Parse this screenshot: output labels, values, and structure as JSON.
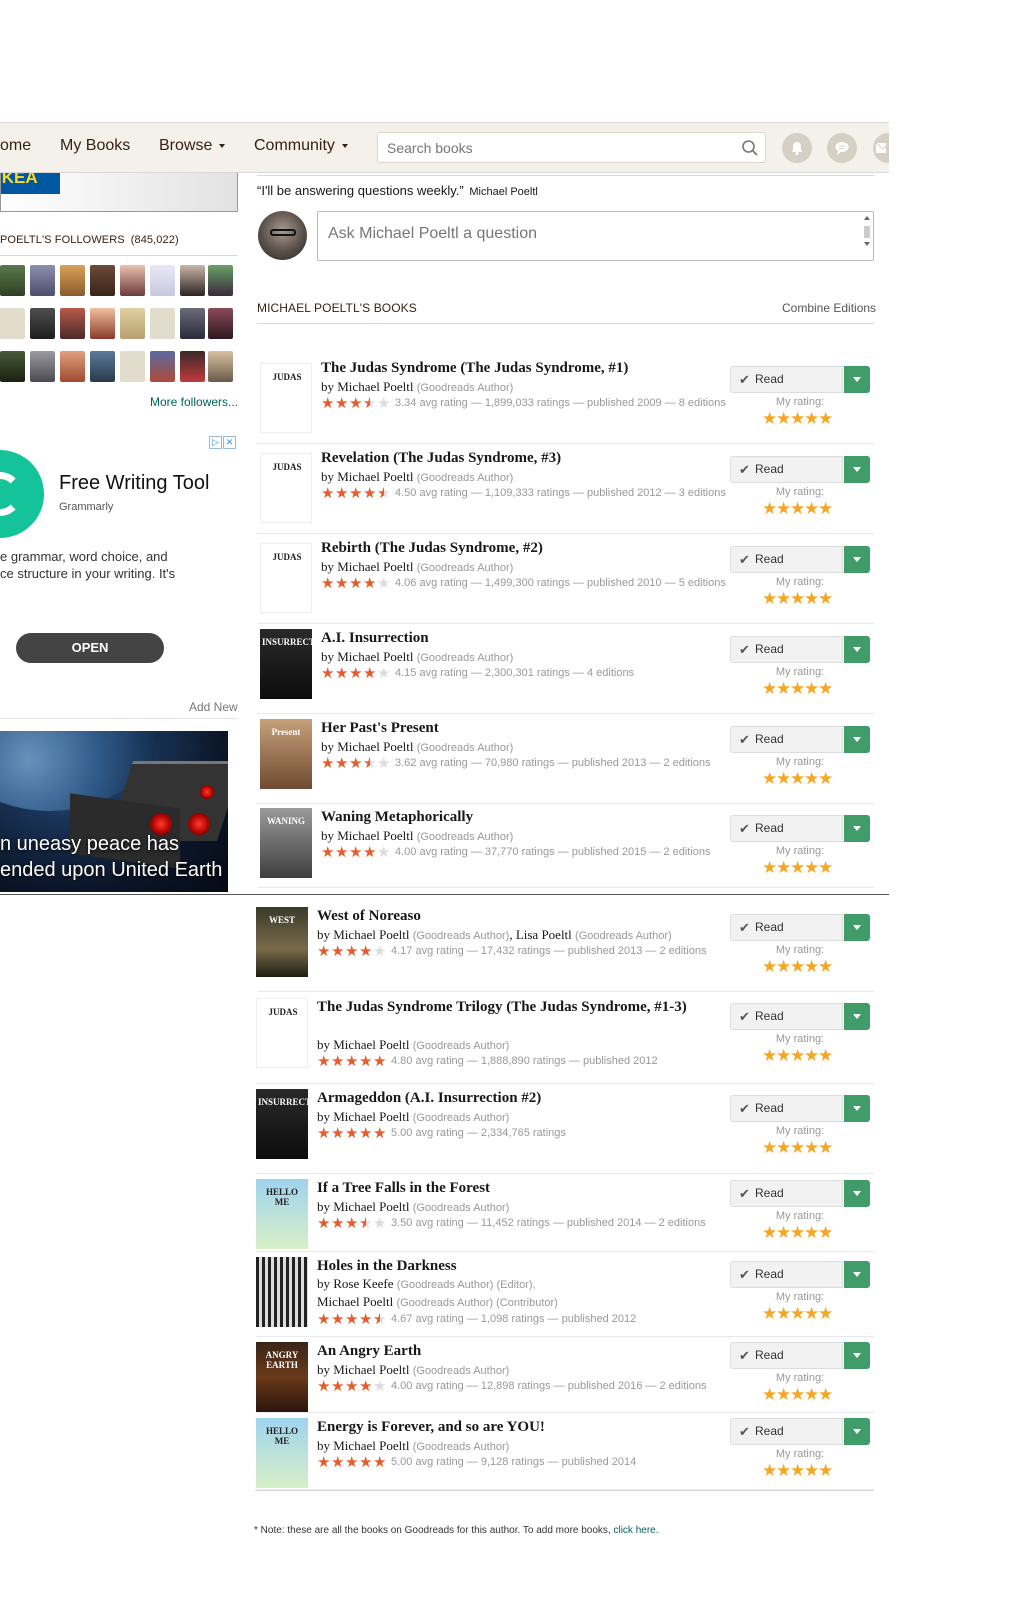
{
  "nav": {
    "home": "ome",
    "my_books": "My Books",
    "browse": "Browse",
    "community": "Community",
    "search_placeholder": "Search books",
    "icons": [
      "bell-icon",
      "chat-icon",
      "mail-icon"
    ]
  },
  "left": {
    "banner_logo": "IKEA",
    "followers_title": "POELTL'S FOLLOWERS",
    "followers_count": "(845,022)",
    "more_followers": "More followers...",
    "ad": {
      "title": "Free Writing Tool",
      "brand": "Grammarly",
      "body_line1": "e grammar, word choice, and",
      "body_line2": "ce structure in your writing. It's",
      "button": "OPEN"
    },
    "add_new": "Add New",
    "space_ad_line1": "n uneasy peace has",
    "space_ad_line2": "ended upon United Earth"
  },
  "main": {
    "quote": "“I'll be answering questions weekly.”",
    "quote_author": "Michael Poeltl",
    "ask_placeholder": "Ask Michael Poeltl a question",
    "books_header": "MICHAEL POELTL'S BOOKS",
    "combine_editions": "Combine Editions",
    "read_label": "Read",
    "my_rating_label": "My rating:",
    "note_text": "* Note: these are all the books on Goodreads for this author. To add more books,",
    "note_link": "click here."
  },
  "colors": {
    "nav_bg": "#f4f1ea",
    "rating_star": "#e85b2a",
    "user_star": "#f5a623",
    "shelf_green": "#409d69",
    "link": "#00635d"
  },
  "books": [
    {
      "title": "The Judas Syndrome (The Judas Syndrome, #1)",
      "authors": [
        {
          "name": "Michael Poeltl",
          "role": "(Goodreads Author)"
        }
      ],
      "rating": 3.34,
      "stats": "3.34 avg rating — 1,899,033  ratings — published 2009 — 8 editions"
    },
    {
      "title": "Revelation (The Judas Syndrome, #3)",
      "authors": [
        {
          "name": "Michael Poeltl",
          "role": "(Goodreads Author)"
        }
      ],
      "rating": 4.5,
      "stats": "4.50 avg rating — 1,109,333  ratings — published 2012 — 3 editions"
    },
    {
      "title": "Rebirth (The Judas Syndrome, #2)",
      "authors": [
        {
          "name": "Michael Poeltl",
          "role": "(Goodreads Author)"
        }
      ],
      "rating": 4.06,
      "stats": "4.06 avg rating — 1,499,300  ratings — published 2010 — 5 editions"
    },
    {
      "title": "A.I. Insurrection",
      "authors": [
        {
          "name": "Michael Poeltl",
          "role": "(Goodreads Author)"
        }
      ],
      "rating": 4.15,
      "stats": "4.15 avg rating — 2,300,301  ratings — 4 editions"
    },
    {
      "title": "Her Past's Present",
      "authors": [
        {
          "name": "Michael Poeltl",
          "role": "(Goodreads Author)"
        }
      ],
      "rating": 3.62,
      "stats": "3.62 avg rating — 70,980  ratings — published 2013 — 2 editions"
    },
    {
      "title": "Waning Metaphorically",
      "authors": [
        {
          "name": "Michael Poeltl",
          "role": "(Goodreads Author)"
        }
      ],
      "rating": 4.0,
      "stats": "4.00 avg rating — 37,770  ratings — published 2015 — 2 editions"
    },
    {
      "title": "West of Noreaso",
      "authors": [
        {
          "name": "Michael Poeltl",
          "role": "(Goodreads Author)"
        },
        {
          "name": "Lisa Poeltl",
          "role": "(Goodreads Author)"
        }
      ],
      "rating": 4.17,
      "stats": "4.17 avg rating — 17,432  ratings — published 2013 — 2 editions"
    },
    {
      "title": "The Judas Syndrome Trilogy (The Judas Syndrome, #1-3)",
      "authors": [
        {
          "name": "Michael Poeltl",
          "role": "(Goodreads Author)"
        }
      ],
      "rating": 4.8,
      "stats": "4.80 avg rating — 1,888,890  ratings — published 2012"
    },
    {
      "title": "Armageddon (A.I. Insurrection #2)",
      "authors": [
        {
          "name": "Michael Poeltl",
          "role": "(Goodreads Author)"
        }
      ],
      "rating": 5.0,
      "stats": "5.00 avg rating — 2,334,765  ratings"
    },
    {
      "title": "If a Tree Falls in the Forest",
      "authors": [
        {
          "name": "Michael Poeltl",
          "role": "(Goodreads Author)"
        }
      ],
      "rating": 3.5,
      "stats": "3.50 avg rating — 11,452  ratings — published 2014 — 2 editions"
    },
    {
      "title": "Holes in the Darkness",
      "authors": [
        {
          "name": "Rose Keefe",
          "role": "(Goodreads Author) (Editor),"
        },
        {
          "name": "Michael Poeltl",
          "role": "(Goodreads Author) (Contributor)"
        }
      ],
      "rating": 4.67,
      "stats": "4.67 avg rating — 1,098  ratings — published 2012"
    },
    {
      "title": "An Angry Earth",
      "authors": [
        {
          "name": "Michael Poeltl",
          "role": "(Goodreads Author)"
        }
      ],
      "rating": 4.0,
      "stats": "4.00 avg rating — 12,898  ratings — published 2016 — 2 editions"
    },
    {
      "title": "Energy is Forever, and so are YOU!",
      "authors": [
        {
          "name": "Michael Poeltl",
          "role": "(Goodreads Author)"
        }
      ],
      "rating": 5.0,
      "stats": "5.00 avg rating — 9,128  ratings — published 2014"
    }
  ],
  "covers": [
    {
      "label": "JUDAS",
      "style": "white"
    },
    {
      "label": "JUDAS",
      "style": "white"
    },
    {
      "label": "JUDAS",
      "style": "white"
    },
    {
      "label": "INSURRECTION",
      "style": "dark"
    },
    {
      "label": "Present",
      "style": "sepia"
    },
    {
      "label": "WANING",
      "style": "gray"
    },
    {
      "label": "WEST",
      "style": "tree"
    },
    {
      "label": "JUDAS",
      "style": "white"
    },
    {
      "label": "INSURRECTION",
      "style": "dark"
    },
    {
      "label": "HELLO ME",
      "style": "sky"
    },
    {
      "label": "",
      "style": "bars"
    },
    {
      "label": "ANGRY EARTH",
      "style": "brown"
    },
    {
      "label": "HELLO ME",
      "style": "sky"
    }
  ]
}
